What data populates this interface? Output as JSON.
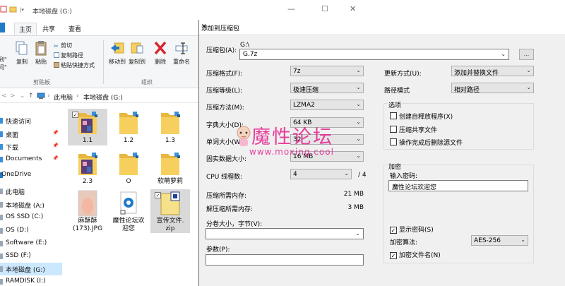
{
  "explorer": {
    "title": "本地磁盘 (G:)",
    "tabs": [
      "主页",
      "共享",
      "查看"
    ],
    "ribbon": {
      "clipboard": {
        "pin_label": "到\"\n问\"",
        "copy": "复制",
        "paste": "粘贴",
        "cut": "剪切",
        "copy_path": "复制路径",
        "paste_shortcut": "粘贴快捷方式",
        "group": "剪贴板"
      },
      "organize": {
        "move_to": "移动到",
        "copy_to": "复制到",
        "delete": "删除",
        "rename": "重命名",
        "group": "组织"
      }
    },
    "address": {
      "path_pc": "此电脑",
      "path_drive": "本地磁盘 (G:)"
    },
    "nav": [
      {
        "label": "快速访问",
        "pinned": false,
        "selected": false
      },
      {
        "label": "桌面",
        "pinned": true,
        "selected": false
      },
      {
        "label": "下载",
        "pinned": true,
        "selected": false
      },
      {
        "label": "Documents",
        "pinned": true,
        "selected": false
      },
      {
        "label": "OneDrive",
        "pinned": false,
        "selected": false
      },
      {
        "label": "此电脑",
        "pinned": false,
        "selected": false
      },
      {
        "label": "本地磁盘 (A:)",
        "pinned": false,
        "selected": false
      },
      {
        "label": "OS SSD (C:)",
        "pinned": false,
        "selected": false
      },
      {
        "label": "OS (D:)",
        "pinned": false,
        "selected": false
      },
      {
        "label": "Software (E:)",
        "pinned": false,
        "selected": false
      },
      {
        "label": "SSD (F:)",
        "pinned": false,
        "selected": false
      },
      {
        "label": "本地磁盘 (G:)",
        "pinned": false,
        "selected": true
      },
      {
        "label": "RAMDISK (I:)",
        "pinned": false,
        "selected": false
      }
    ],
    "pin_glyph": "📌",
    "files": [
      {
        "name": "1.1",
        "icon": "folder-image-icon",
        "selected": true
      },
      {
        "name": "1.2",
        "icon": "folder-icon",
        "selected": false
      },
      {
        "name": "1.3",
        "icon": "folder-icon",
        "selected": false
      },
      {
        "name": "2.3",
        "icon": "folder-image-icon",
        "selected": false
      },
      {
        "name": "O",
        "icon": "folder-icon",
        "selected": false
      },
      {
        "name": "软萌萝莉",
        "icon": "folder-icon",
        "selected": false
      },
      {
        "name": "麻酥酥\n(173).JPG",
        "icon": "image-file-icon",
        "selected": false
      },
      {
        "name": "魔性论坛欢\n迎您",
        "icon": "edge-shortcut-icon",
        "selected": false
      },
      {
        "name": "宣传文件.\nzip",
        "icon": "zip-file-icon",
        "selected": true
      }
    ]
  },
  "dialog": {
    "title": "添加到压缩包",
    "archive_label": "压缩包(A):",
    "archive_dir": "G:\\",
    "archive_name": "G.7z",
    "browse": "...",
    "format_label": "压缩格式(F):",
    "format": "7z",
    "level_label": "压缩等级(L):",
    "level": "极速压缩",
    "method_label": "压缩方法(M):",
    "method": "LZMA2",
    "dict_label": "字典大小(D):",
    "dict": "64 KB",
    "word_label": "单词大小(W):",
    "word": "32",
    "solid_label": "固实数据大小:",
    "solid": "16 MB",
    "threads_label": "CPU 线程数:",
    "threads": "4",
    "threads_max": "/ 4",
    "mem_comp_label": "压缩所需内存:",
    "mem_comp": "21 MB",
    "mem_decomp_label": "解压缩所需内存:",
    "mem_decomp": "3 MB",
    "split_label": "分卷大小，字节(V):",
    "split": "",
    "params_label": "参数(P):",
    "params": "",
    "update_label": "更新方式(U):",
    "update": "添加并替换文件",
    "path_label": "路径模式",
    "path_mode": "相对路径",
    "options_title": "选项",
    "opt_sfx": "创建自释放程序(X)",
    "opt_shared": "压缩共享文件",
    "opt_delete": "操作完成后删除源文件",
    "enc_title": "加密",
    "pwd_label": "输入密码:",
    "pwd_value": "魔性论坛欢迎您",
    "show_pwd": "显示密码(S)",
    "enc_method_label": "加密算法:",
    "enc_method": "AES-256",
    "enc_names": "加密文件名(N)",
    "checks": {
      "sfx": false,
      "shared": false,
      "delete": false,
      "show_pwd": true,
      "enc_names": true
    },
    "check_glyph": "✓"
  },
  "watermark": {
    "text": "魔性论坛",
    "url": "www.moxing.cool"
  },
  "colors": {
    "accent": "#1f7ac8",
    "selection": "#cce8ff",
    "watermark": "#e4218d",
    "folder": "#f6cf5e"
  }
}
